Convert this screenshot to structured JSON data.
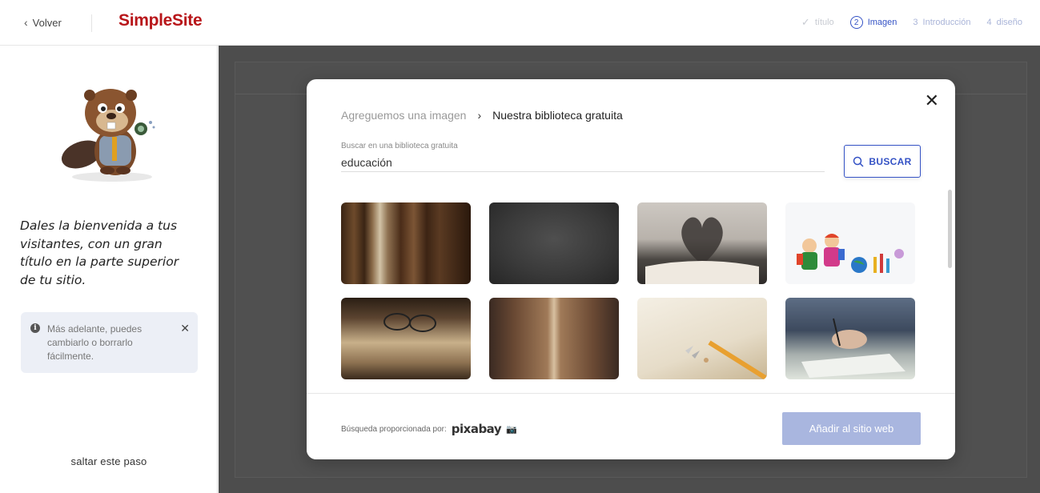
{
  "header": {
    "back_label": "Volver",
    "logo": "SimpleSite",
    "steps": [
      {
        "label": "título",
        "status": "done"
      },
      {
        "num": "2",
        "label": "Imagen",
        "status": "active"
      },
      {
        "num": "3",
        "label": "Introducción",
        "status": "pending"
      },
      {
        "num": "4",
        "label": "diseño",
        "status": "pending"
      }
    ]
  },
  "sidebar": {
    "welcome_text": "Dales la bienvenida a tus visitantes, con un gran título en la parte superior de tu sitio.",
    "tip_text": "Más adelante, puedes cambiarlo o borrarlo fácilmente.",
    "skip_label": "saltar este paso"
  },
  "modal": {
    "breadcrumb_prev": "Agreguemos una imagen",
    "breadcrumb_current": "Nuestra biblioteca gratuita",
    "search_label": "Buscar en una biblioteca gratuita",
    "search_value": "educación",
    "search_button": "BUSCAR",
    "images": [
      {
        "name": "old-books-image"
      },
      {
        "name": "chalkboard-image"
      },
      {
        "name": "heart-book-pages-image"
      },
      {
        "name": "school-kids-illustration-image"
      },
      {
        "name": "open-book-glasses-image"
      },
      {
        "name": "library-shelves-image"
      },
      {
        "name": "notebook-pencil-image"
      },
      {
        "name": "hand-writing-image"
      }
    ],
    "powered_by": "Búsqueda proporcionada por:",
    "provider": "pixabay",
    "add_button": "Añadir al sitio web"
  },
  "colors": {
    "brand_red": "#b8161a",
    "accent_blue": "#3452c5",
    "disabled_blue": "#a9b6df"
  }
}
